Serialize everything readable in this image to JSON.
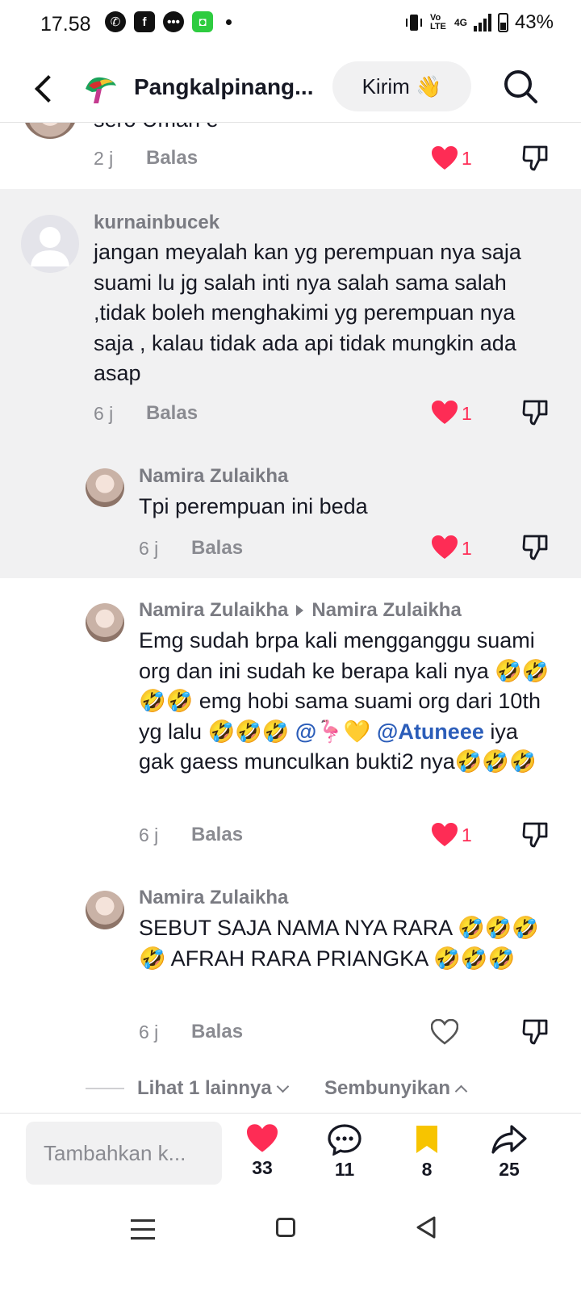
{
  "status_bar": {
    "time": "17.58",
    "battery": "43%",
    "network_labels": [
      "Vo LTE",
      "4G"
    ]
  },
  "header": {
    "title": "Pangkalpinang...",
    "send_label": "Kirim 👋"
  },
  "comments": [
    {
      "partial_text": "sero Uman e",
      "time": "2 j",
      "reply_label": "Balas",
      "likes": "1",
      "liked": true
    },
    {
      "username": "kurnainbucek",
      "text": "jangan meyalah kan yg perempuan nya saja suami lu jg salah inti nya salah sama salah ,tidak boleh menghakimi yg perempuan nya saja , kalau tidak ada api tidak mungkin ada asap",
      "time": "6 j",
      "reply_label": "Balas",
      "likes": "1",
      "liked": true
    },
    {
      "username": "Namira Zulaikha",
      "text": "Tpi perempuan ini beda",
      "time": "6 j",
      "reply_label": "Balas",
      "likes": "1",
      "liked": true
    },
    {
      "username": "Namira Zulaikha",
      "reply_to": "Namira Zulaikha",
      "text_parts": [
        "Emg sudah brpa kali mengganggu suami org dan ini sudah ke berapa kali nya 🤣🤣🤣🤣 emg hobi sama suami org dari 10th yg lalu 🤣🤣🤣 ",
        "@🦩💛",
        "@Atuneee",
        " iya gak gaess munculkan bukti2 nya🤣🤣🤣"
      ],
      "time": "6 j",
      "reply_label": "Balas",
      "likes": "1",
      "liked": true
    },
    {
      "username": "Namira Zulaikha",
      "text": "SEBUT SAJA NAMA NYA RARA 🤣🤣🤣🤣 AFRAH RARA PRIANGKA 🤣🤣🤣",
      "time": "6 j",
      "reply_label": "Balas",
      "likes": "",
      "liked": false
    }
  ],
  "replies_footer": {
    "more_label": "Lihat 1 lainnya",
    "hide_label": "Sembunyikan"
  },
  "bottom_bar": {
    "input_placeholder": "Tambahkan k...",
    "likes": "33",
    "comments": "11",
    "saves": "8",
    "shares": "25"
  },
  "colors": {
    "accent_red": "#fe2c55",
    "mention_blue": "#2b5db9",
    "bookmark_yellow": "#f7c400",
    "highlight_bg": "#f1f1f2"
  }
}
